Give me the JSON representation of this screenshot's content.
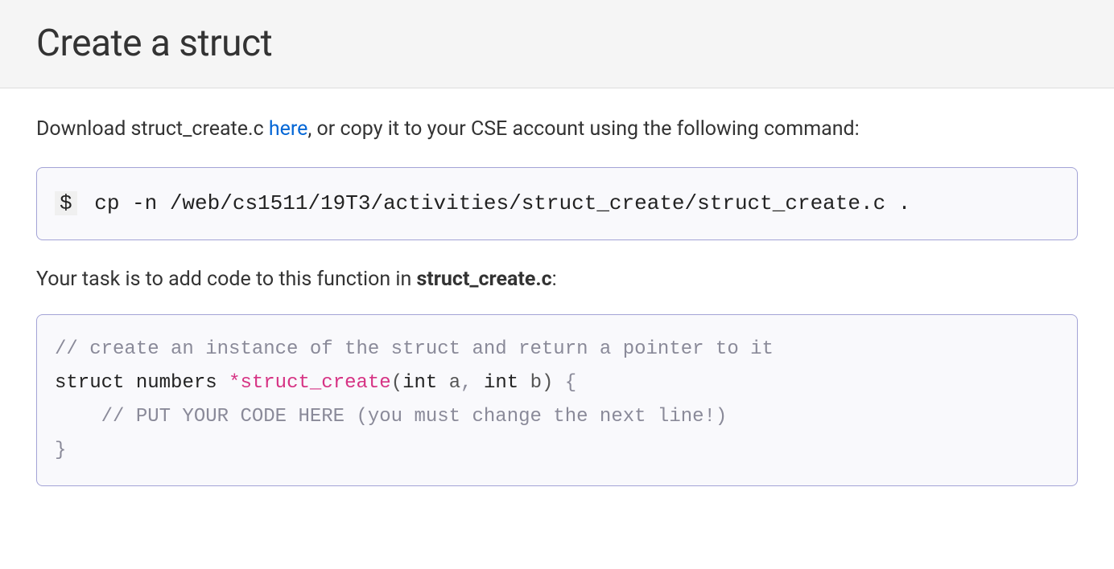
{
  "header": {
    "title": "Create a struct"
  },
  "intro": {
    "prefix": "Download struct_create.c ",
    "link_text": "here",
    "suffix": ", or copy it to your CSE account using the following command:"
  },
  "command": {
    "prompt": "$",
    "text": "cp -n /web/cs1511/19T3/activities/struct_create/struct_create.c ."
  },
  "task": {
    "prefix": "Your task is to add code to this function in ",
    "filename": "struct_create.c",
    "suffix": ":"
  },
  "code": {
    "comment1": "// create an instance of the struct and return a pointer to it",
    "kw_struct": "struct",
    "type_numbers": "numbers",
    "star": "*",
    "funcname": "struct_create",
    "paren_open": "(",
    "kw_int1": "int",
    "param_a": "a",
    "comma": ",",
    "kw_int2": "int",
    "param_b": "b",
    "paren_close": ")",
    "brace_open": "{",
    "comment2": "// PUT YOUR CODE HERE (you must change the next line!)",
    "brace_close": "}"
  }
}
